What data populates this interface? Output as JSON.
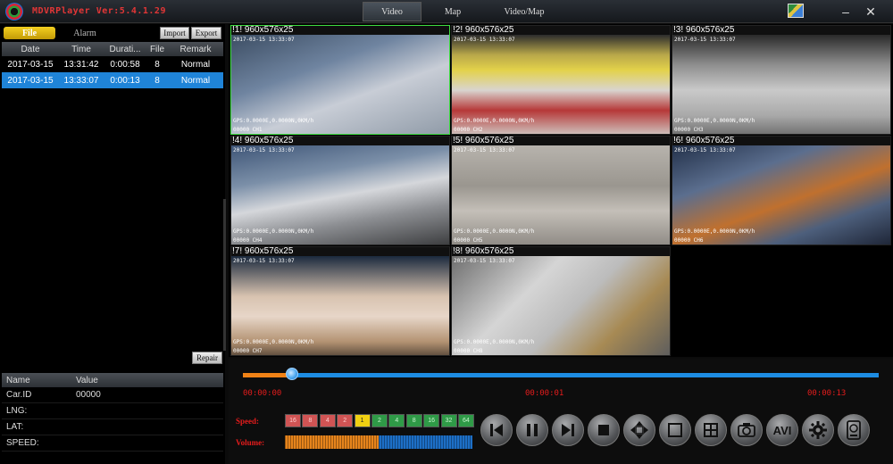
{
  "app": {
    "title": "MDVRPlayer Ver:5.4.1.29"
  },
  "main_tabs": [
    {
      "label": "Video",
      "active": true
    },
    {
      "label": "Map",
      "active": false
    },
    {
      "label": "Video/Map",
      "active": false
    }
  ],
  "left_panel": {
    "tabs": [
      {
        "label": "File",
        "active": true
      },
      {
        "label": "Alarm",
        "active": false
      }
    ],
    "import_label": "Import",
    "export_label": "Export",
    "repair_label": "Repair",
    "file_table": {
      "columns": [
        "Date",
        "Time",
        "Durati...",
        "File",
        "Remark"
      ],
      "rows": [
        {
          "date": "2017-03-15",
          "time": "13:31:42",
          "duration": "0:00:58",
          "file": "8",
          "remark": "Normal",
          "selected": false
        },
        {
          "date": "2017-03-15",
          "time": "13:33:07",
          "duration": "0:00:13",
          "file": "8",
          "remark": "Normal",
          "selected": true
        }
      ]
    },
    "info_table": {
      "columns": [
        "Name",
        "Value"
      ],
      "rows": [
        {
          "name": "Car.ID",
          "value": "00000"
        },
        {
          "name": "LNG:",
          "value": ""
        },
        {
          "name": "LAT:",
          "value": ""
        },
        {
          "name": "SPEED:",
          "value": ""
        }
      ]
    }
  },
  "video_grid": {
    "cells": [
      {
        "header": "!1! 960x576x25",
        "timestamp": "2017-03-15 13:33:07",
        "gps": "GPS:0.0000E,0.0000N,0KM/h",
        "channel": "00000  CH1",
        "active": true
      },
      {
        "header": "!2! 960x576x25",
        "timestamp": "2017-03-15 13:33:07",
        "gps": "GPS:0.0000E,0.0000N,0KM/h",
        "channel": "00000  CH2",
        "active": false
      },
      {
        "header": "!3! 960x576x25",
        "timestamp": "2017-03-15 13:33:07",
        "gps": "GPS:0.0000E,0.0000N,0KM/h",
        "channel": "00000  CH3",
        "active": false
      },
      {
        "header": "!4! 960x576x25",
        "timestamp": "2017-03-15 13:33:07",
        "gps": "GPS:0.0000E,0.0000N,0KM/h",
        "channel": "00000  CH4",
        "active": false
      },
      {
        "header": "!5! 960x576x25",
        "timestamp": "2017-03-15 13:33:07",
        "gps": "GPS:0.0000E,0.0000N,0KM/h",
        "channel": "00000  CH5",
        "active": false
      },
      {
        "header": "!6! 960x576x25",
        "timestamp": "2017-03-15 13:33:07",
        "gps": "GPS:0.0000E,0.0000N,0KM/h",
        "channel": "00000  CH6",
        "active": false
      },
      {
        "header": "!7! 960x576x25",
        "timestamp": "2017-03-15 13:33:07",
        "gps": "GPS:0.0000E,0.0000N,0KM/h",
        "channel": "00000  CH7",
        "active": false
      },
      {
        "header": "!8! 960x576x25",
        "timestamp": "2017-03-15 13:33:07",
        "gps": "GPS:0.0000E,0.0000N,0KM/h",
        "channel": "00000  CH8",
        "active": false
      }
    ]
  },
  "playback": {
    "start_time": "00:00:00",
    "current_time": "00:00:01",
    "end_time": "00:00:13",
    "progress_fraction": 0.077,
    "speed_label": "Speed:",
    "volume_label": "Volume:",
    "speeds": [
      "16",
      "8",
      "4",
      "2",
      "1",
      "2",
      "4",
      "8",
      "16",
      "32",
      "64"
    ],
    "current_speed_index": 4,
    "volume_fraction": 0.5,
    "avi_label": "AVI"
  },
  "colors": {
    "accent": "#1f84d8",
    "timer_red": "#e51c1c",
    "progress_orange": "#f08216",
    "file_tab_yellow": "#f4d020",
    "active_cell_border": "#3ddc40"
  }
}
